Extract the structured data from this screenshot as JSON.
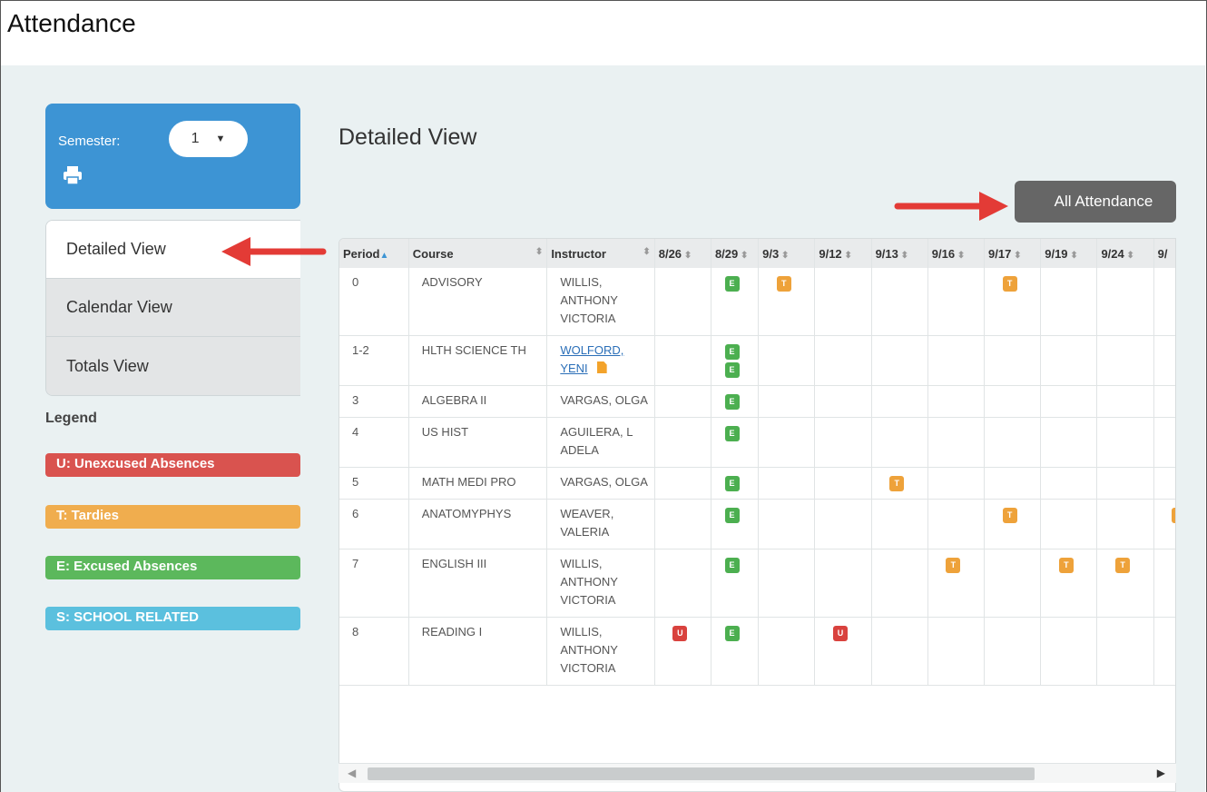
{
  "page": {
    "title": "Attendance"
  },
  "semester": {
    "label": "Semester:",
    "value": "1"
  },
  "tabs": [
    {
      "label": "Detailed View",
      "active": true
    },
    {
      "label": "Calendar View",
      "active": false
    },
    {
      "label": "Totals View",
      "active": false
    }
  ],
  "legend": {
    "title": "Legend",
    "items": [
      {
        "label": "U: Unexcused Absences",
        "color": "#d9534f"
      },
      {
        "label": "T: Tardies",
        "color": "#f0ad4e"
      },
      {
        "label": "E: Excused Absences",
        "color": "#5cb85c"
      },
      {
        "label": "S: SCHOOL RELATED",
        "color": "#5bc0de"
      }
    ]
  },
  "main": {
    "title": "Detailed View",
    "all_attendance_label": "All Attendance"
  },
  "table": {
    "headers": [
      "Period",
      "Course",
      "Instructor",
      "8/26",
      "8/29",
      "9/3",
      "9/12",
      "9/13",
      "9/16",
      "9/17",
      "9/19",
      "9/24",
      "9/"
    ],
    "rows": [
      {
        "period": "0",
        "course": "ADVISORY",
        "instructor": "WILLIS, ANTHONY VICTORIA",
        "link": false,
        "marks": [
          "",
          "E",
          "T",
          "",
          "",
          "",
          "T",
          "",
          "",
          ""
        ]
      },
      {
        "period": "1-2",
        "course": "HLTH SCIENCE TH",
        "instructor": "WOLFORD, YENI",
        "link": true,
        "marks": [
          "",
          "E E",
          "",
          "",
          "",
          "",
          "",
          "",
          "",
          ""
        ]
      },
      {
        "period": "3",
        "course": "ALGEBRA II",
        "instructor": "VARGAS, OLGA",
        "link": false,
        "marks": [
          "",
          "E",
          "",
          "",
          "",
          "",
          "",
          "",
          "",
          ""
        ]
      },
      {
        "period": "4",
        "course": "US HIST",
        "instructor": "AGUILERA, L ADELA",
        "link": false,
        "marks": [
          "",
          "E",
          "",
          "",
          "",
          "",
          "",
          "",
          "",
          ""
        ]
      },
      {
        "period": "5",
        "course": "MATH MEDI PRO",
        "instructor": "VARGAS, OLGA",
        "link": false,
        "marks": [
          "",
          "E",
          "",
          "",
          "T",
          "",
          "",
          "",
          "",
          ""
        ]
      },
      {
        "period": "6",
        "course": "ANATOMYPHYS",
        "instructor": "WEAVER, VALERIA",
        "link": false,
        "marks": [
          "",
          "E",
          "",
          "",
          "",
          "",
          "T",
          "",
          "",
          "T"
        ]
      },
      {
        "period": "7",
        "course": "ENGLISH III",
        "instructor": "WILLIS, ANTHONY VICTORIA",
        "link": false,
        "marks": [
          "",
          "E",
          "",
          "",
          "",
          "T",
          "",
          "T",
          "T",
          ""
        ]
      },
      {
        "period": "8",
        "course": "READING I",
        "instructor": "WILLIS, ANTHONY VICTORIA",
        "link": false,
        "marks": [
          "U",
          "E",
          "",
          "U",
          "",
          "",
          "",
          "",
          "",
          ""
        ]
      }
    ]
  }
}
